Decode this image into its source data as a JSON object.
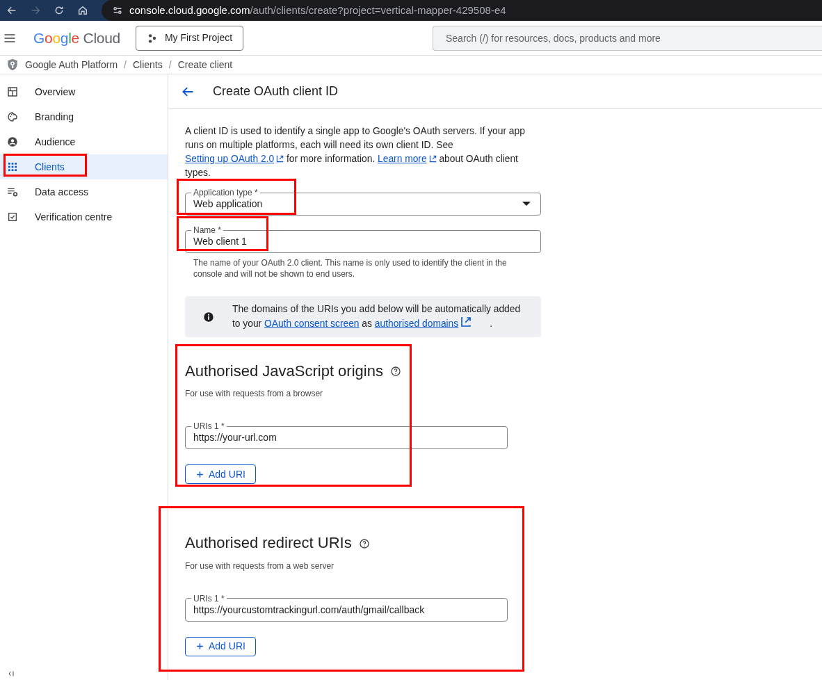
{
  "browser": {
    "url_host": "console.cloud.google.com",
    "url_path": "/auth/clients/create?project=vertical-mapper-429508-e4"
  },
  "header": {
    "logo_word": "Google",
    "logo_product": "Cloud",
    "project": "My First Project",
    "search": {
      "placeholder": "Search (/) for resources, docs, products and more"
    }
  },
  "breadcrumb": [
    {
      "kind": "link",
      "text": "Google Auth Platform"
    },
    {
      "kind": "separator",
      "text": "/"
    },
    {
      "kind": "link",
      "text": "Clients"
    },
    {
      "kind": "separator",
      "text": "/"
    },
    {
      "kind": "link",
      "text": "Create client"
    }
  ],
  "sidebar": {
    "items": [
      {
        "label": "Overview",
        "selected": false,
        "highlighted": false
      },
      {
        "label": "Branding",
        "selected": false,
        "highlighted": false
      },
      {
        "label": "Audience",
        "selected": false,
        "highlighted": false
      },
      {
        "label": "Clients",
        "selected": true,
        "highlighted": true
      },
      {
        "label": "Data access",
        "selected": false,
        "highlighted": false
      },
      {
        "label": "Verification centre",
        "selected": false,
        "highlighted": false
      }
    ]
  },
  "page": {
    "title": "Create OAuth client ID",
    "intro": [
      {
        "kind": "text",
        "text": "A client ID is used to identify a single app to Google's OAuth servers. If your app runs on multiple platforms, each will need its own client ID. See "
      },
      {
        "kind": "link",
        "text": "Setting up OAuth 2.0",
        "external": true
      },
      {
        "kind": "text",
        "text": " for more information. "
      },
      {
        "kind": "link",
        "text": "Learn more",
        "external": true
      },
      {
        "kind": "text",
        "text": " about OAuth client types."
      }
    ],
    "application_type": {
      "label": "Application type *",
      "value": "Web application",
      "highlighted": true
    },
    "name": {
      "label": "Name *",
      "value": "Web client 1",
      "highlighted": true,
      "hint": "The name of your OAuth 2.0 client. This name is only used to identify the client in the console and will not be shown to end users."
    },
    "info": [
      {
        "kind": "text",
        "text": "The domains of the URIs you add below will be automatically added to your "
      },
      {
        "kind": "link",
        "text": "OAuth consent screen",
        "external": false
      },
      {
        "kind": "text",
        "text": " as "
      },
      {
        "kind": "link",
        "text": "authorised domains",
        "external": true
      },
      {
        "kind": "text",
        "text": "."
      }
    ],
    "sections": [
      {
        "title": "Authorised JavaScript origins",
        "subtitle": "For use with requests from a browser",
        "uris": [
          {
            "label": "URIs 1 *",
            "value": "https://your-url.com"
          }
        ],
        "add_button": "Add URI",
        "highlighted": true
      },
      {
        "title": "Authorised redirect URIs",
        "subtitle": "For use with requests from a web server",
        "uris": [
          {
            "label": "URIs 1 *",
            "value": "https://yourcustomtrackingurl.com/auth/gmail/callback"
          }
        ],
        "add_button": "Add URI",
        "highlighted": true
      }
    ]
  }
}
